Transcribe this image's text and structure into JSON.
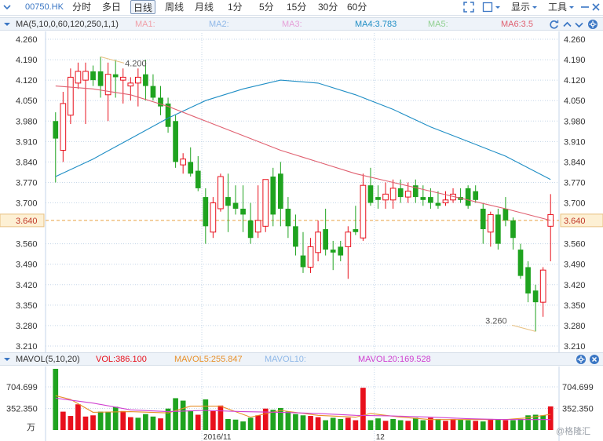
{
  "toolbar": {
    "code": "00750.HK",
    "periods": [
      "分时",
      "多日",
      "日线",
      "周线",
      "月线",
      "1分",
      "5分",
      "15分",
      "30分",
      "60分"
    ],
    "active_period": "日线",
    "show_label": "显示",
    "tools_label": "工具"
  },
  "ma_legend": {
    "title": "MA(5,10,0,60,120,250,1,1)",
    "ma1": "MA1:",
    "ma2": "MA2:",
    "ma3": "MA3:",
    "ma4": "MA4:3.783",
    "ma5": "MA5:",
    "ma6": "MA6:3.5"
  },
  "vol_legend": {
    "title": "MAVOL(5,10,20)",
    "vol": "VOL:386.100",
    "mavol5": "MAVOL5:255.847",
    "mavol10": "MAVOL10:",
    "mavol20": "MAVOL20:169.528"
  },
  "colors": {
    "up": "#e8101c",
    "down": "#1fa31f",
    "ma4": "#1f8ec5",
    "ma6": "#e06070",
    "mavol5": "#e8902a",
    "mavol20": "#d040d0",
    "grid": "#c5d6e8",
    "axis_text": "#333333",
    "current_price_line": "#e8a040"
  },
  "watermark": "@格隆汇",
  "chart_data": [
    {
      "type": "candlestick",
      "price_ticks": [
        "4.260",
        "4.190",
        "4.120",
        "4.050",
        "3.980",
        "3.910",
        "3.840",
        "3.770",
        "3.700",
        "3.640",
        "3.560",
        "3.490",
        "3.420",
        "3.350",
        "3.280",
        "3.210"
      ],
      "current_price": "3.640",
      "high_annotation": "4.200",
      "low_annotation": "3.260",
      "x_labels": [
        "2016/11",
        "12"
      ],
      "ylim": [
        3.21,
        4.26
      ],
      "candles": [
        {
          "o": 3.98,
          "h": 4.01,
          "l": 3.77,
          "c": 3.92
        },
        {
          "o": 3.88,
          "h": 4.08,
          "l": 3.84,
          "c": 4.04
        },
        {
          "o": 4.0,
          "h": 4.16,
          "l": 3.97,
          "c": 4.13
        },
        {
          "o": 4.11,
          "h": 4.18,
          "l": 4.09,
          "c": 4.15
        },
        {
          "o": 4.12,
          "h": 4.18,
          "l": 3.97,
          "c": 4.15
        },
        {
          "o": 4.15,
          "h": 4.17,
          "l": 4.1,
          "c": 4.12
        },
        {
          "o": 4.15,
          "h": 4.2,
          "l": 4.06,
          "c": 4.1
        },
        {
          "o": 4.07,
          "h": 4.18,
          "l": 3.98,
          "c": 4.14
        },
        {
          "o": 4.14,
          "h": 4.19,
          "l": 4.06,
          "c": 4.13
        },
        {
          "o": 4.12,
          "h": 4.16,
          "l": 4.04,
          "c": 4.13
        },
        {
          "o": 4.1,
          "h": 4.13,
          "l": 4.05,
          "c": 4.11
        },
        {
          "o": 4.11,
          "h": 4.16,
          "l": 4.03,
          "c": 4.13
        },
        {
          "o": 4.14,
          "h": 4.19,
          "l": 4.05,
          "c": 4.1
        },
        {
          "o": 4.1,
          "h": 4.14,
          "l": 4.05,
          "c": 4.06
        },
        {
          "o": 4.06,
          "h": 4.1,
          "l": 4.0,
          "c": 4.03
        },
        {
          "o": 4.04,
          "h": 4.06,
          "l": 3.94,
          "c": 3.96
        },
        {
          "o": 3.98,
          "h": 4.0,
          "l": 3.82,
          "c": 3.84
        },
        {
          "o": 3.83,
          "h": 3.87,
          "l": 3.8,
          "c": 3.85
        },
        {
          "o": 3.84,
          "h": 3.89,
          "l": 3.79,
          "c": 3.8
        },
        {
          "o": 3.81,
          "h": 3.86,
          "l": 3.74,
          "c": 3.75
        },
        {
          "o": 3.72,
          "h": 3.75,
          "l": 3.56,
          "c": 3.62
        },
        {
          "o": 3.6,
          "h": 3.72,
          "l": 3.58,
          "c": 3.7
        },
        {
          "o": 3.68,
          "h": 3.8,
          "l": 3.67,
          "c": 3.79
        },
        {
          "o": 3.72,
          "h": 3.8,
          "l": 3.6,
          "c": 3.69
        },
        {
          "o": 3.7,
          "h": 3.76,
          "l": 3.66,
          "c": 3.68
        },
        {
          "o": 3.68,
          "h": 3.76,
          "l": 3.6,
          "c": 3.66
        },
        {
          "o": 3.64,
          "h": 3.7,
          "l": 3.56,
          "c": 3.58
        },
        {
          "o": 3.6,
          "h": 3.76,
          "l": 3.58,
          "c": 3.64
        },
        {
          "o": 3.62,
          "h": 3.75,
          "l": 3.6,
          "c": 3.78
        },
        {
          "o": 3.79,
          "h": 3.82,
          "l": 3.62,
          "c": 3.66
        },
        {
          "o": 3.8,
          "h": 3.84,
          "l": 3.62,
          "c": 3.68
        },
        {
          "o": 3.68,
          "h": 3.72,
          "l": 3.58,
          "c": 3.62
        },
        {
          "o": 3.62,
          "h": 3.66,
          "l": 3.52,
          "c": 3.55
        },
        {
          "o": 3.52,
          "h": 3.6,
          "l": 3.46,
          "c": 3.48
        },
        {
          "o": 3.48,
          "h": 3.58,
          "l": 3.46,
          "c": 3.55
        },
        {
          "o": 3.53,
          "h": 3.64,
          "l": 3.5,
          "c": 3.6
        },
        {
          "o": 3.61,
          "h": 3.68,
          "l": 3.52,
          "c": 3.54
        },
        {
          "o": 3.54,
          "h": 3.57,
          "l": 3.47,
          "c": 3.53
        },
        {
          "o": 3.55,
          "h": 3.57,
          "l": 3.5,
          "c": 3.52
        },
        {
          "o": 3.55,
          "h": 3.62,
          "l": 3.44,
          "c": 3.6
        },
        {
          "o": 3.61,
          "h": 3.69,
          "l": 3.59,
          "c": 3.6
        },
        {
          "o": 3.58,
          "h": 3.8,
          "l": 3.57,
          "c": 3.76
        },
        {
          "o": 3.76,
          "h": 3.82,
          "l": 3.69,
          "c": 3.7
        },
        {
          "o": 3.72,
          "h": 3.76,
          "l": 3.68,
          "c": 3.71
        },
        {
          "o": 3.71,
          "h": 3.77,
          "l": 3.68,
          "c": 3.73
        },
        {
          "o": 3.71,
          "h": 3.78,
          "l": 3.68,
          "c": 3.75
        },
        {
          "o": 3.75,
          "h": 3.78,
          "l": 3.7,
          "c": 3.72
        },
        {
          "o": 3.72,
          "h": 3.77,
          "l": 3.7,
          "c": 3.74
        },
        {
          "o": 3.76,
          "h": 3.78,
          "l": 3.7,
          "c": 3.72
        },
        {
          "o": 3.72,
          "h": 3.76,
          "l": 3.69,
          "c": 3.71
        },
        {
          "o": 3.72,
          "h": 3.75,
          "l": 3.68,
          "c": 3.7
        },
        {
          "o": 3.7,
          "h": 3.74,
          "l": 3.68,
          "c": 3.69
        },
        {
          "o": 3.7,
          "h": 3.74,
          "l": 3.69,
          "c": 3.71
        },
        {
          "o": 3.71,
          "h": 3.75,
          "l": 3.7,
          "c": 3.73
        },
        {
          "o": 3.72,
          "h": 3.75,
          "l": 3.7,
          "c": 3.71
        },
        {
          "o": 3.75,
          "h": 3.76,
          "l": 3.68,
          "c": 3.69
        },
        {
          "o": 3.74,
          "h": 3.76,
          "l": 3.7,
          "c": 3.71
        },
        {
          "o": 3.68,
          "h": 3.7,
          "l": 3.56,
          "c": 3.61
        },
        {
          "o": 3.6,
          "h": 3.67,
          "l": 3.55,
          "c": 3.66
        },
        {
          "o": 3.66,
          "h": 3.68,
          "l": 3.54,
          "c": 3.56
        },
        {
          "o": 3.68,
          "h": 3.72,
          "l": 3.62,
          "c": 3.64
        },
        {
          "o": 3.64,
          "h": 3.65,
          "l": 3.54,
          "c": 3.58
        },
        {
          "o": 3.54,
          "h": 3.56,
          "l": 3.44,
          "c": 3.45
        },
        {
          "o": 3.48,
          "h": 3.5,
          "l": 3.36,
          "c": 3.39
        },
        {
          "o": 3.4,
          "h": 3.42,
          "l": 3.26,
          "c": 3.36
        },
        {
          "o": 3.36,
          "h": 3.48,
          "l": 3.31,
          "c": 3.47
        },
        {
          "o": 3.62,
          "h": 3.73,
          "l": 3.5,
          "c": 3.66
        }
      ],
      "ma4": {
        "label": "MA4:3.783",
        "points": [
          {
            "i": 0,
            "v": 3.79
          },
          {
            "i": 5,
            "v": 3.85
          },
          {
            "i": 10,
            "v": 3.92
          },
          {
            "i": 15,
            "v": 3.99
          },
          {
            "i": 20,
            "v": 4.05
          },
          {
            "i": 25,
            "v": 4.09
          },
          {
            "i": 30,
            "v": 4.12
          },
          {
            "i": 35,
            "v": 4.11
          },
          {
            "i": 40,
            "v": 4.07
          },
          {
            "i": 45,
            "v": 4.02
          },
          {
            "i": 50,
            "v": 3.96
          },
          {
            "i": 55,
            "v": 3.91
          },
          {
            "i": 60,
            "v": 3.86
          },
          {
            "i": 66,
            "v": 3.78
          }
        ]
      },
      "ma6": {
        "label": "MA6:3.5",
        "points": [
          {
            "i": 0,
            "v": 4.1
          },
          {
            "i": 5,
            "v": 4.09
          },
          {
            "i": 10,
            "v": 4.07
          },
          {
            "i": 15,
            "v": 4.03
          },
          {
            "i": 20,
            "v": 3.98
          },
          {
            "i": 25,
            "v": 3.93
          },
          {
            "i": 30,
            "v": 3.88
          },
          {
            "i": 35,
            "v": 3.84
          },
          {
            "i": 40,
            "v": 3.8
          },
          {
            "i": 45,
            "v": 3.77
          },
          {
            "i": 50,
            "v": 3.74
          },
          {
            "i": 55,
            "v": 3.71
          },
          {
            "i": 60,
            "v": 3.68
          },
          {
            "i": 66,
            "v": 3.64
          }
        ]
      }
    },
    {
      "type": "bar",
      "volume_ticks": [
        "704.699",
        "352.350",
        "万"
      ],
      "ylim": [
        0,
        1000
      ],
      "volumes": [
        {
          "v": 1000,
          "up": false
        },
        {
          "v": 300,
          "up": true
        },
        {
          "v": 230,
          "up": true
        },
        {
          "v": 420,
          "up": true
        },
        {
          "v": 220,
          "up": true
        },
        {
          "v": 240,
          "up": true
        },
        {
          "v": 300,
          "up": false
        },
        {
          "v": 300,
          "up": false
        },
        {
          "v": 380,
          "up": false
        },
        {
          "v": 310,
          "up": true
        },
        {
          "v": 210,
          "up": true
        },
        {
          "v": 200,
          "up": false
        },
        {
          "v": 260,
          "up": false
        },
        {
          "v": 220,
          "up": false
        },
        {
          "v": 190,
          "up": true
        },
        {
          "v": 350,
          "up": false
        },
        {
          "v": 520,
          "up": false
        },
        {
          "v": 480,
          "up": false
        },
        {
          "v": 320,
          "up": false
        },
        {
          "v": 250,
          "up": true
        },
        {
          "v": 500,
          "up": false
        },
        {
          "v": 310,
          "up": true
        },
        {
          "v": 400,
          "up": true
        },
        {
          "v": 180,
          "up": false
        },
        {
          "v": 170,
          "up": false
        },
        {
          "v": 140,
          "up": false
        },
        {
          "v": 200,
          "up": false
        },
        {
          "v": 240,
          "up": true
        },
        {
          "v": 350,
          "up": true
        },
        {
          "v": 330,
          "up": false
        },
        {
          "v": 360,
          "up": false
        },
        {
          "v": 300,
          "up": false
        },
        {
          "v": 260,
          "up": false
        },
        {
          "v": 240,
          "up": false
        },
        {
          "v": 230,
          "up": true
        },
        {
          "v": 210,
          "up": true
        },
        {
          "v": 160,
          "up": false
        },
        {
          "v": 200,
          "up": false
        },
        {
          "v": 180,
          "up": false
        },
        {
          "v": 200,
          "up": true
        },
        {
          "v": 160,
          "up": true
        },
        {
          "v": 690,
          "up": true
        },
        {
          "v": 160,
          "up": false
        },
        {
          "v": 190,
          "up": false
        },
        {
          "v": 150,
          "up": true
        },
        {
          "v": 180,
          "up": false
        },
        {
          "v": 160,
          "up": false
        },
        {
          "v": 150,
          "up": true
        },
        {
          "v": 200,
          "up": false
        },
        {
          "v": 160,
          "up": false
        },
        {
          "v": 200,
          "up": true
        },
        {
          "v": 180,
          "up": false
        },
        {
          "v": 150,
          "up": true
        },
        {
          "v": 180,
          "up": true
        },
        {
          "v": 170,
          "up": false
        },
        {
          "v": 160,
          "up": false
        },
        {
          "v": 150,
          "up": true
        },
        {
          "v": 140,
          "up": false
        },
        {
          "v": 180,
          "up": true
        },
        {
          "v": 170,
          "up": false
        },
        {
          "v": 160,
          "up": true
        },
        {
          "v": 160,
          "up": false
        },
        {
          "v": 180,
          "up": false
        },
        {
          "v": 240,
          "up": false
        },
        {
          "v": 250,
          "up": false
        },
        {
          "v": 240,
          "up": false
        },
        {
          "v": 386,
          "up": true
        }
      ],
      "mavol5_points": [
        {
          "i": 0,
          "v": 560
        },
        {
          "i": 2,
          "v": 500
        },
        {
          "i": 5,
          "v": 290
        },
        {
          "i": 10,
          "v": 300
        },
        {
          "i": 15,
          "v": 280
        },
        {
          "i": 18,
          "v": 390
        },
        {
          "i": 22,
          "v": 390
        },
        {
          "i": 26,
          "v": 210
        },
        {
          "i": 30,
          "v": 320
        },
        {
          "i": 35,
          "v": 240
        },
        {
          "i": 40,
          "v": 210
        },
        {
          "i": 42,
          "v": 270
        },
        {
          "i": 46,
          "v": 210
        },
        {
          "i": 50,
          "v": 170
        },
        {
          "i": 55,
          "v": 170
        },
        {
          "i": 60,
          "v": 170
        },
        {
          "i": 63,
          "v": 200
        },
        {
          "i": 66,
          "v": 256
        }
      ],
      "mavol20_points": [
        {
          "i": 0,
          "v": 520
        },
        {
          "i": 5,
          "v": 440
        },
        {
          "i": 10,
          "v": 330
        },
        {
          "i": 15,
          "v": 300
        },
        {
          "i": 20,
          "v": 320
        },
        {
          "i": 25,
          "v": 300
        },
        {
          "i": 30,
          "v": 290
        },
        {
          "i": 35,
          "v": 270
        },
        {
          "i": 40,
          "v": 240
        },
        {
          "i": 45,
          "v": 230
        },
        {
          "i": 50,
          "v": 210
        },
        {
          "i": 55,
          "v": 185
        },
        {
          "i": 60,
          "v": 170
        },
        {
          "i": 66,
          "v": 170
        }
      ]
    }
  ]
}
